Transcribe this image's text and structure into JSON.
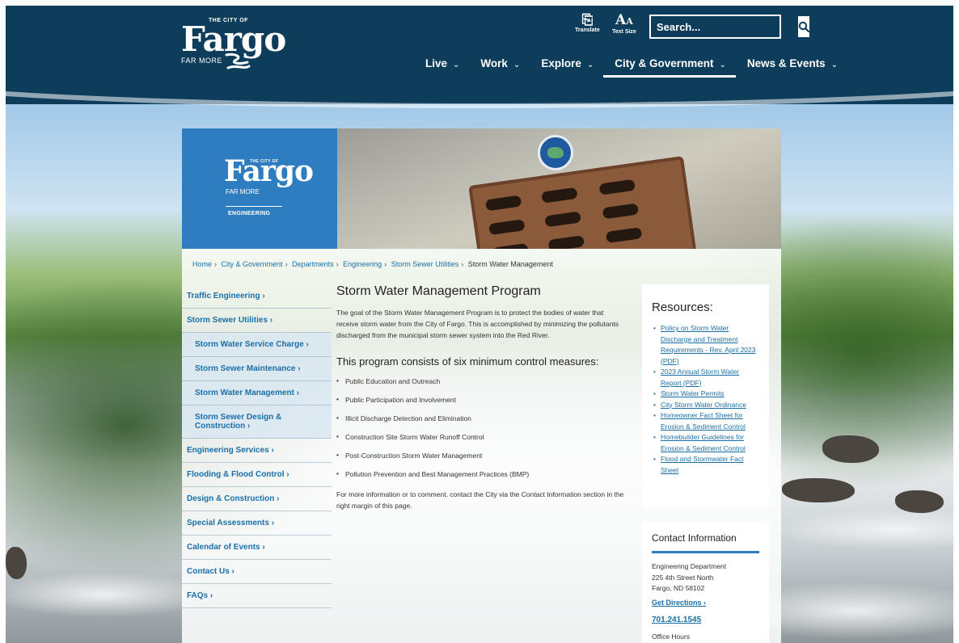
{
  "header": {
    "logo": {
      "small": "THE CITY OF",
      "big": "Fargo",
      "tagline": "FAR MORE"
    },
    "translate_label": "Translate",
    "text_size_label": "Text Size",
    "search": {
      "placeholder": "Search..."
    },
    "nav": [
      {
        "label": "Live",
        "active": false
      },
      {
        "label": "Work",
        "active": false
      },
      {
        "label": "Explore",
        "active": false
      },
      {
        "label": "City & Government",
        "active": true
      },
      {
        "label": "News & Events",
        "active": false
      }
    ]
  },
  "banner": {
    "logo": {
      "small": "THE CITY OF",
      "big": "Fargo",
      "tagline": "FAR MORE",
      "dept": "ENGINEERING"
    }
  },
  "breadcrumb": [
    "Home",
    "City & Government",
    "Departments",
    "Engineering",
    "Storm Sewer Utilities",
    "Storm Water Management"
  ],
  "sidemenu": [
    {
      "label": "Traffic Engineering ›",
      "sub": false
    },
    {
      "label": "Storm Sewer Utilities ›",
      "sub": false
    },
    {
      "label": "Storm Water Service Charge ›",
      "sub": true
    },
    {
      "label": "Storm Sewer Maintenance ›",
      "sub": true
    },
    {
      "label": "Storm Water Management ›",
      "sub": true
    },
    {
      "label": "Storm Sewer Design & Construction ›",
      "sub": true
    },
    {
      "label": "Engineering Services ›",
      "sub": false
    },
    {
      "label": "Flooding & Flood Control ›",
      "sub": false
    },
    {
      "label": "Design & Construction ›",
      "sub": false
    },
    {
      "label": "Special Assessments ›",
      "sub": false
    },
    {
      "label": "Calendar of Events ›",
      "sub": false
    },
    {
      "label": "Contact Us ›",
      "sub": false
    },
    {
      "label": "FAQs ›",
      "sub": false
    }
  ],
  "main": {
    "title": "Storm Water Management Program",
    "intro": "The goal of the Storm Water Management Program is to protect the bodies of water that receive storm water from the City of Fargo. This is accomplished by minimizing the pollutants discharged from the municipal storm sewer system into the Red River.",
    "subtitle": "This program consists of six minimum control measures:",
    "measures": [
      "Public Education and Outreach",
      "Public Participation and Involvement",
      "Illicit Discharge Detection and Elimination",
      "Construction Site Storm Water Runoff Control",
      "Post-Construction Storm Water Management",
      "Pollution Prevention and Best Management Practices (BMP)"
    ],
    "closing": "For more information or to comment, contact the City via the Contact Information section in the right margin of this page."
  },
  "resources": {
    "title": "Resources:",
    "links": [
      "Policy on Storm Water Discharge and Treatment Requirements - Rev. April 2023 (PDF)",
      "2023 Annual Storm Water Report (PDF)",
      "Storm Water Permits",
      "City Storm Water Ordinance",
      "Homeowner Fact Sheet for Erosion & Sediment Control",
      "Homebuilder Guidelines for Erosion & Sediment Control",
      "Flood and Stormwater Fact Sheet"
    ]
  },
  "contact": {
    "title": "Contact Information",
    "department": "Engineering Department",
    "street": "225 4th Street North",
    "city": "Fargo, ND 58102",
    "directions": "Get Directions ›",
    "phone": "701.241.1545",
    "hours_label": "Office Hours"
  },
  "colors": {
    "header_navy": "#0e3d5c",
    "engineering_blue": "#2f7dc1",
    "link_blue": "#1a6fa8"
  },
  "icons": [
    "translate-icon",
    "text-size-icon",
    "search-icon",
    "chevron-down-icon"
  ]
}
